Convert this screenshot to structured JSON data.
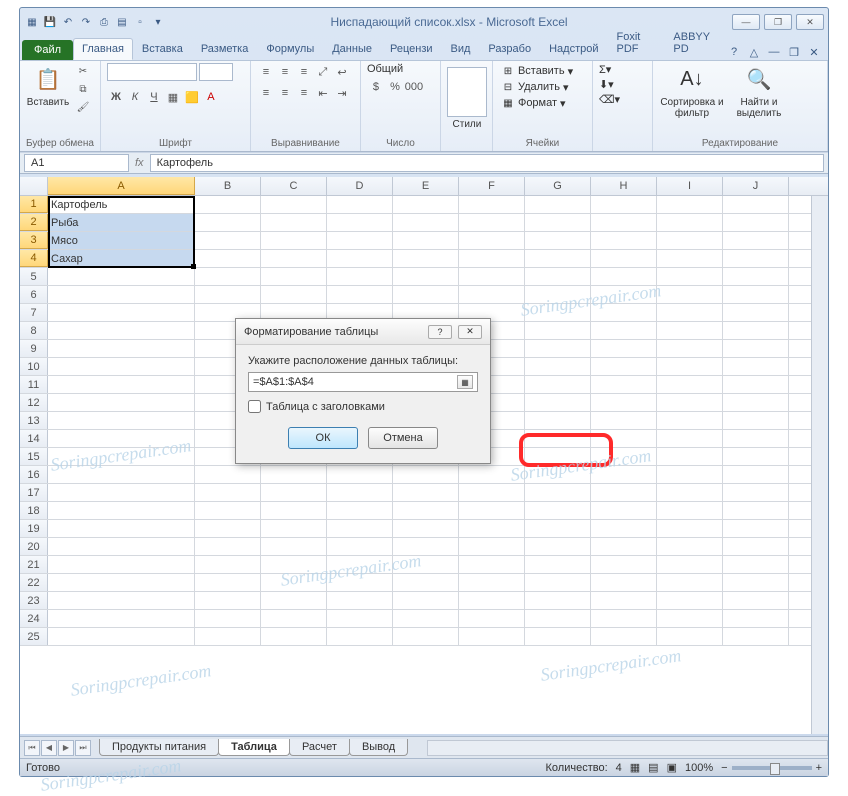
{
  "app": {
    "title": "Ниспадающий список.xlsx - Microsoft Excel"
  },
  "qat": {
    "icons": [
      "excel",
      "save",
      "undo",
      "redo",
      "print",
      "open",
      "new",
      "dd"
    ]
  },
  "winbuttons": {
    "min": "—",
    "max": "❐",
    "close": "✕"
  },
  "tabs": {
    "file": "Файл",
    "items": [
      "Главная",
      "Вставка",
      "Разметка",
      "Формулы",
      "Данные",
      "Рецензи",
      "Вид",
      "Разрабо",
      "Надстрой",
      "Foxit PDF",
      "ABBYY PD"
    ],
    "active": 0
  },
  "ribbon_help": {
    "help": "?",
    "minimize": "△",
    "win_min": "—",
    "win_max": "❐",
    "win_close": "✕"
  },
  "ribbon": {
    "clipboard": {
      "paste": "Вставить",
      "label": "Буфер обмена"
    },
    "font": {
      "name": "",
      "size": "",
      "label": "Шрифт",
      "bold": "Ж",
      "italic": "К",
      "underline": "Ч"
    },
    "align": {
      "label": "Выравнивание"
    },
    "number": {
      "format": "Общий",
      "label": "Число"
    },
    "styles": {
      "label": "Стили",
      "btn": "Стили"
    },
    "cells": {
      "insert": "Вставить",
      "delete": "Удалить",
      "format": "Формат",
      "label": "Ячейки"
    },
    "editing": {
      "sort": "Сортировка и фильтр",
      "find": "Найти и выделить",
      "label": "Редактирование"
    }
  },
  "namebox": {
    "value": "A1"
  },
  "formula": {
    "label": "fx",
    "value": "Картофель"
  },
  "columns": [
    "A",
    "B",
    "C",
    "D",
    "E",
    "F",
    "G",
    "H",
    "I",
    "J"
  ],
  "row_count": 25,
  "cells": {
    "A1": "Картофель",
    "A2": "Рыба",
    "A3": "Мясо",
    "A4": "Сахар"
  },
  "selected_rows": [
    1,
    2,
    3,
    4
  ],
  "sheets": {
    "tabs": [
      "Продукты питания",
      "Таблица",
      "Расчет",
      "Вывод"
    ],
    "active": 1
  },
  "status": {
    "ready": "Готово",
    "count_label": "Количество:",
    "count": "4",
    "zoom": "100%"
  },
  "dialog": {
    "title": "Форматирование таблицы",
    "label": "Укажите расположение данных таблицы:",
    "range": "=$A$1:$A$4",
    "checkbox": "Таблица с заголовками",
    "ok": "ОК",
    "cancel": "Отмена"
  },
  "watermark": "Soringpcrepair.com"
}
